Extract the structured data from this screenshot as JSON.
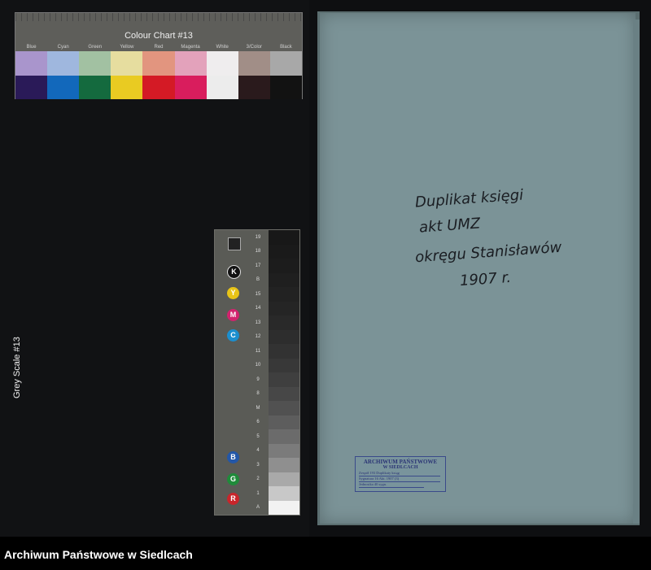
{
  "colour_chart": {
    "title": "Colour Chart #13",
    "patch_names": [
      "Blue",
      "Cyan",
      "Green",
      "Yellow",
      "Red",
      "Magenta",
      "White",
      "3/Color",
      "Black"
    ],
    "light_colors": [
      "#a995cc",
      "#9fb7de",
      "#a2c1a2",
      "#e6dd9f",
      "#e2957f",
      "#e3a2bb",
      "#efedee",
      "#a18e87",
      "#a8a8a8"
    ],
    "dark_colors": [
      "#2a1a58",
      "#1268bb",
      "#146a3e",
      "#e9cb22",
      "#d41a25",
      "#d91d5d",
      "#ececec",
      "#2a1a1c",
      "#121212"
    ]
  },
  "grey_scale": {
    "title": "Grey Scale #13",
    "letters": [
      "R",
      "G",
      "B",
      "C",
      "M",
      "Y",
      "K"
    ],
    "letter_colors": [
      "#c9252b",
      "#1f8b3a",
      "#2357a8",
      "#1b8fcf",
      "#d2236e",
      "#e8c417",
      "#111111"
    ],
    "numbers": [
      "A",
      "1",
      "2",
      "3",
      "4",
      "5",
      "6",
      "M",
      "8",
      "9",
      "10",
      "11",
      "12",
      "13",
      "14",
      "15",
      "B",
      "17",
      "18",
      "19"
    ],
    "steps": [
      "#f2f2f2",
      "#c8c8c8",
      "#a9a9a9",
      "#8f8f8f",
      "#7b7b7b",
      "#6b6b6b",
      "#5d5d5d",
      "#515151",
      "#474747",
      "#3f3f3f",
      "#383838",
      "#323232",
      "#2d2d2d",
      "#292929",
      "#252525",
      "#222222",
      "#1f1f1f",
      "#1c1c1c",
      "#1a1a1a",
      "#181818"
    ]
  },
  "folder": {
    "handwriting": [
      "Duplikat księgi",
      "akt UMZ",
      "okręgu Stanisławów",
      "1907 r."
    ],
    "stamp": {
      "line1": "ARCHIWUM PAŃSTWOWE",
      "line2": "W SIEDLCACH",
      "line3": "Zespół 193 Duplikaty ksiąg",
      "line4": "Sygnatura 16 Akt. 1907 (3)",
      "line5": "Jednostka 40 sygn."
    }
  },
  "footer": {
    "text": "Archiwum Państwowe w Siedlcach"
  }
}
